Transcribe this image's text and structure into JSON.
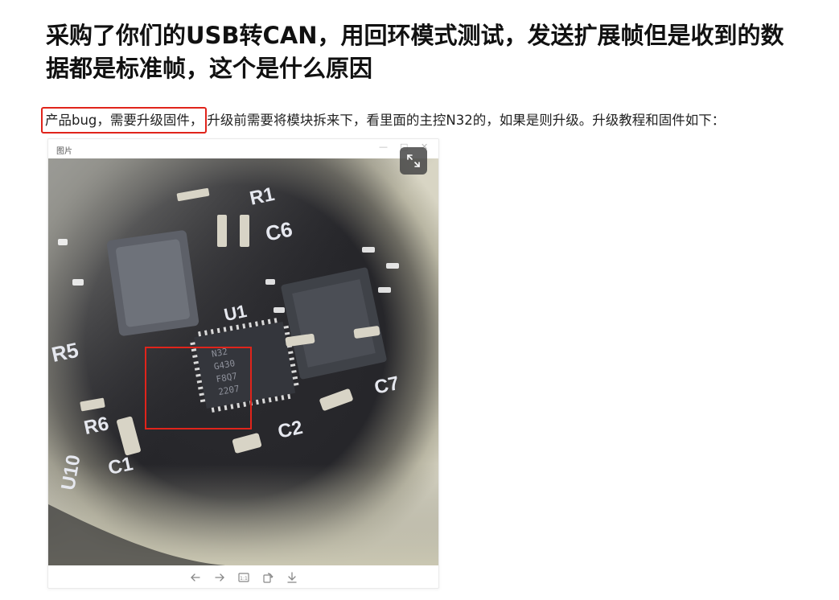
{
  "question": {
    "title": "采购了你们的USB转CAN，用回环模式测试，发送扩展帧但是收到的数据都是标准帧，这个是什么原因"
  },
  "answer": {
    "highlighted": "产品bug，需要升级固件，",
    "rest": "升级前需要将模块拆来下，看里面的主控N32的，如果是则升级。升级教程和固件如下："
  },
  "viewer": {
    "title": "图片",
    "window_buttons": {
      "minimize": "—",
      "maximize": "□",
      "close": "✕"
    },
    "expand_icon": "expand-icon",
    "tools": [
      "arrow-left-icon",
      "arrow-right-icon",
      "actual-size-icon",
      "rotate-icon",
      "download-icon"
    ],
    "actual_size_label": "1:1"
  },
  "photo": {
    "silkscreen": [
      "R5",
      "R6",
      "C1",
      "U10",
      "C2",
      "C7",
      "C6",
      "R1",
      "U1"
    ],
    "chip_marking": [
      "N32",
      "G430",
      "F8Q7",
      "2207"
    ],
    "highlight_color": "#e0241b"
  }
}
